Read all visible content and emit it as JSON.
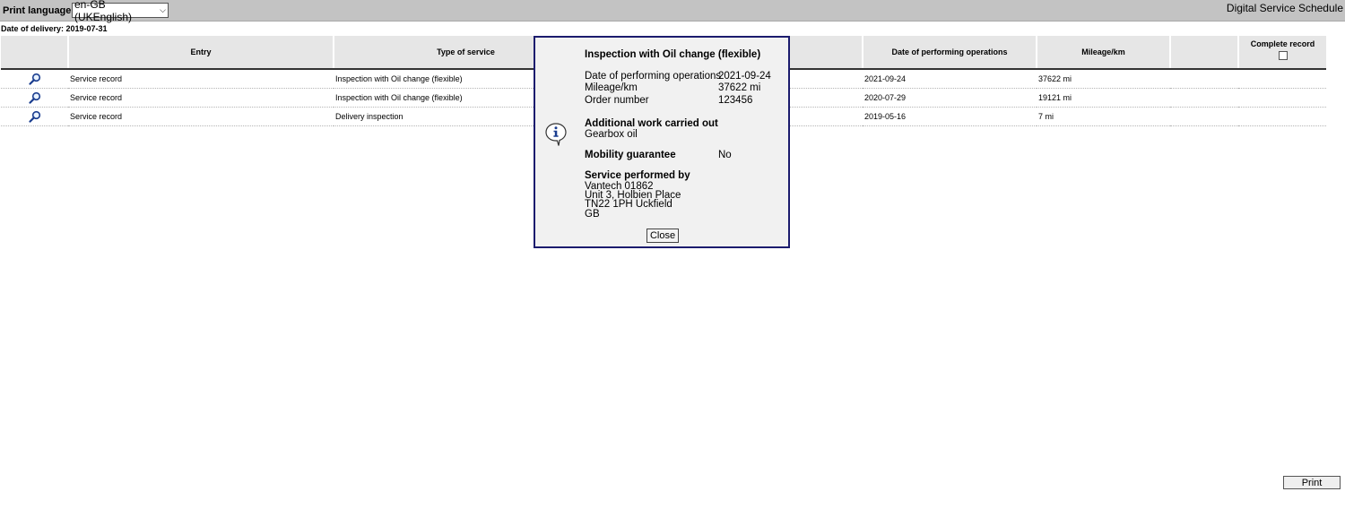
{
  "header": {
    "print_language_label": "Print language:",
    "print_language_value": "en-GB (UKEnglish)",
    "app_title": "Digital Service Schedule"
  },
  "delivery": "Date of delivery: 2019-07-31",
  "table": {
    "columns": [
      "",
      "Entry",
      "Type of service",
      "",
      "Date of performing operations",
      "Mileage/km",
      "",
      "Complete record"
    ],
    "rows": [
      {
        "entry": "Service record",
        "type": "Inspection with Oil change (flexible)",
        "date": "2021-09-24",
        "mileage": "37622 mi"
      },
      {
        "entry": "Service record",
        "type": "Inspection with Oil change (flexible)",
        "date": "2020-07-29",
        "mileage": "19121 mi"
      },
      {
        "entry": "Service record",
        "type": "Delivery inspection",
        "date": "2019-05-16",
        "mileage": "7 mi"
      }
    ]
  },
  "popup": {
    "title": "Inspection with Oil change (flexible)",
    "date_label": "Date of performing operations",
    "date_value": "2021-09-24",
    "mileage_label": "Mileage/km",
    "mileage_value": "37622 mi",
    "order_label": "Order number",
    "order_value": "123456",
    "additional_label": "Additional work carried out",
    "additional_value": "Gearbox oil",
    "mobility_label": "Mobility guarantee",
    "mobility_value": "No",
    "performed_label": "Service performed by",
    "performed_lines": [
      "Vantech 01862",
      "Unit 3, Holbien Place",
      "TN22 1PH Uckfield",
      "GB"
    ],
    "close_label": "Close"
  },
  "print_label": "Print",
  "icons": {
    "row_icon": "magnifier-icon",
    "popup_icon": "info-icon",
    "select_icon": "chevron-down-icon"
  },
  "colors": {
    "topbar": "#c3c3c3",
    "header_bg": "#e6e6e6",
    "popup_border": "#1c1c6e",
    "popup_bg": "#f1f1f1"
  }
}
